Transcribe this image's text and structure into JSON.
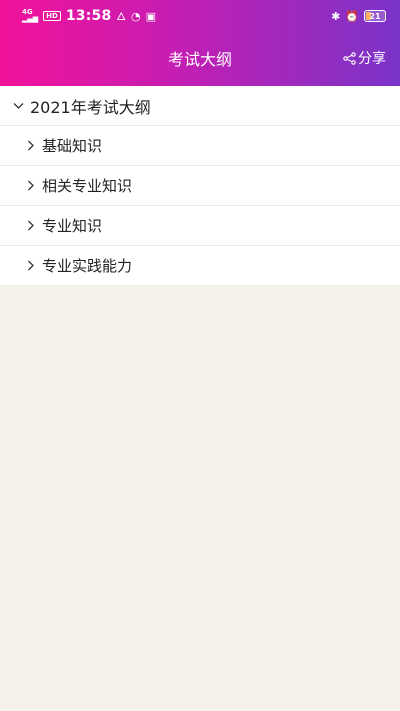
{
  "status_bar": {
    "network": "4G",
    "hd_badge": "HD",
    "time": "13:58",
    "battery": "21"
  },
  "nav": {
    "title": "考试大纲",
    "share_label": "分享"
  },
  "outline": {
    "parent_label": "2021年考试大纲",
    "children": [
      {
        "label": "基础知识"
      },
      {
        "label": "相关专业知识"
      },
      {
        "label": "专业知识"
      },
      {
        "label": "专业实践能力"
      }
    ]
  },
  "colors": {
    "header_gradient_start": "#f2129a",
    "header_gradient_end": "#7a34c8",
    "page_background": "#f6f2ea"
  },
  "icons": [
    "signal-icon",
    "fire-icon",
    "clock-icon",
    "app-icon",
    "bluetooth-icon",
    "alarm-icon",
    "battery-icon",
    "share-icon",
    "chevron-down-icon",
    "chevron-right-icon"
  ]
}
